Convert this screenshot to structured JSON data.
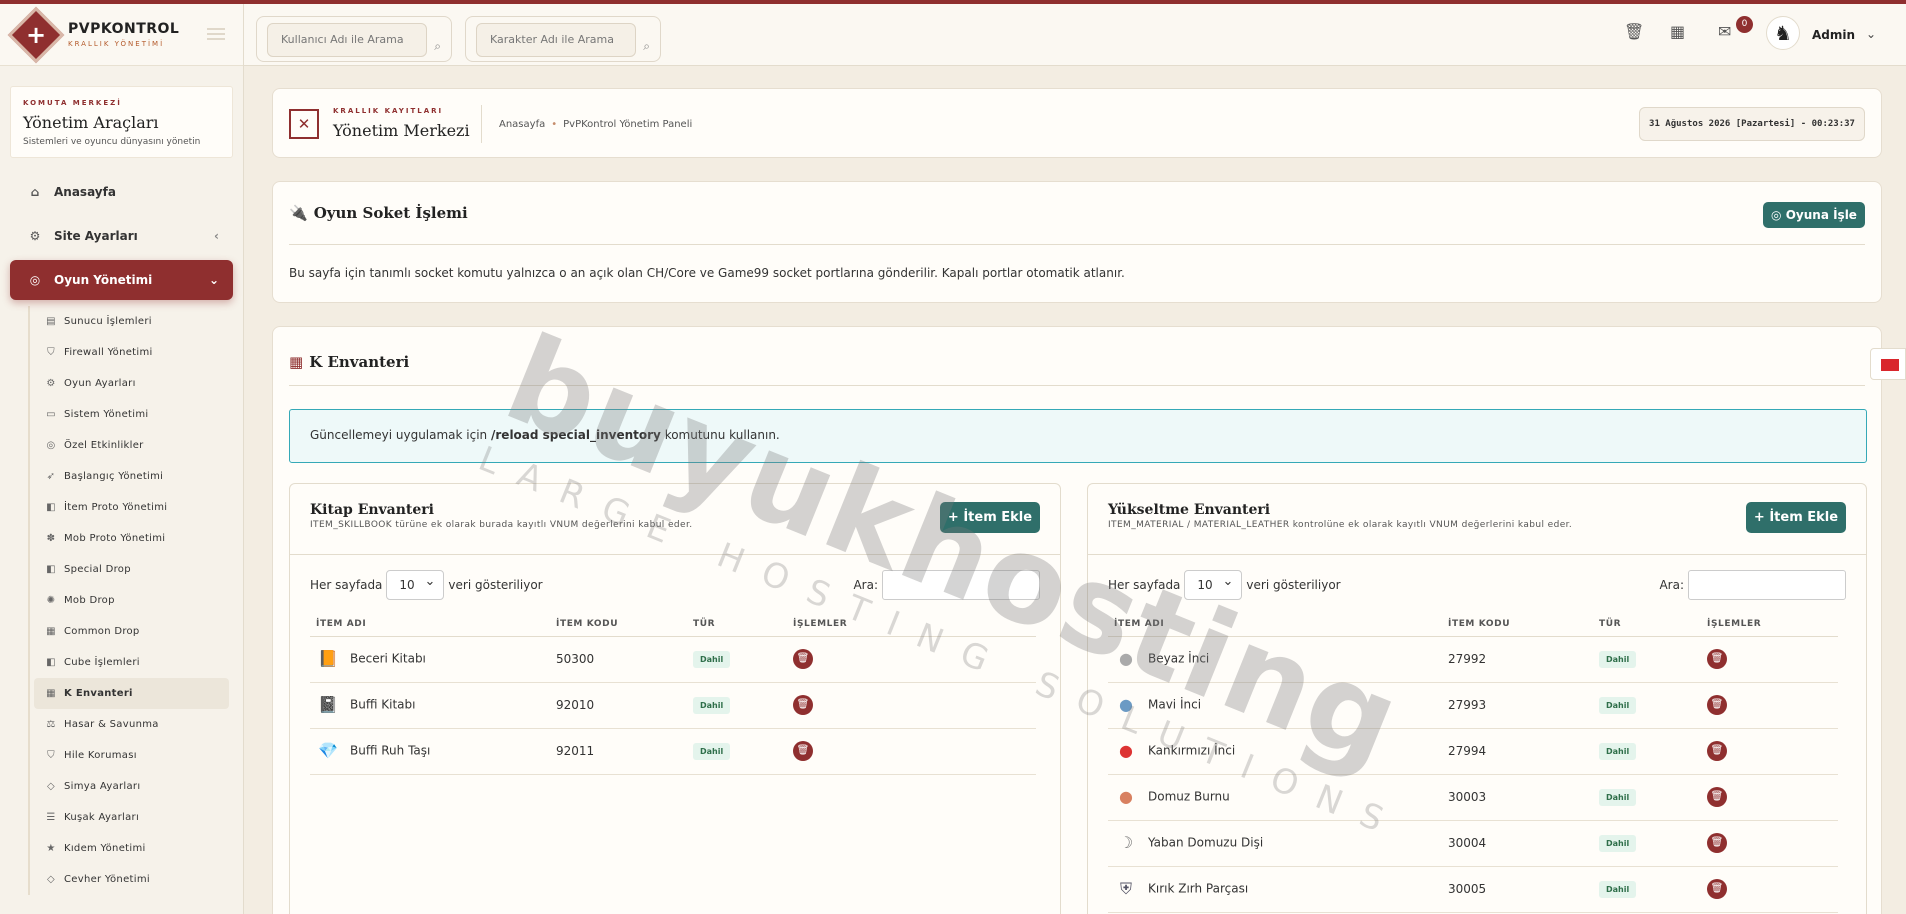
{
  "brand": {
    "title": "PVPKONTROL",
    "subtitle": "KRALLIK YÖNETİMİ"
  },
  "sidecard": {
    "small": "KOMUTA MERKEZİ",
    "title": "Yönetim Araçları",
    "subtitle": "Sistemleri ve oyuncu dünyasını yönetin"
  },
  "nav": {
    "home": "Anasayfa",
    "site_settings": "Site Ayarları",
    "game_management": "Oyun Yönetimi",
    "sub_items": [
      "Sunucu İşlemleri",
      "Firewall Yönetimi",
      "Oyun Ayarları",
      "Sistem Yönetimi",
      "Özel Etkinlikler",
      "Başlangıç Yönetimi",
      "İtem Proto Yönetimi",
      "Mob Proto Yönetimi",
      "Special Drop",
      "Mob Drop",
      "Common Drop",
      "Cube İşlemleri",
      "K Envanteri",
      "Hasar & Savunma",
      "Hile Koruması",
      "Simya Ayarları",
      "Kuşak Ayarları",
      "Kıdem Yönetimi",
      "Cevher Yönetimi"
    ]
  },
  "topbar": {
    "search_user_placeholder": "Kullanıcı Adı ile Arama",
    "search_char_placeholder": "Karakter Adı ile Arama",
    "notification_count": "0",
    "user_name": "Admin"
  },
  "header": {
    "small": "KRALLIK KAYITLARI",
    "title": "Yönetim Merkezi",
    "breadcrumb_home": "Anasayfa",
    "breadcrumb_current": "PvPKontrol Yönetim Paneli",
    "datetime": "31 Ağustos 2026 [Pazartesi] - 00:23:37"
  },
  "socket": {
    "title": "Oyun Soket İşlemi",
    "button": "Oyuna İşle",
    "text": "Bu sayfa için tanımlı socket komutu yalnızca o an açık olan CH/Core ve Game99 socket portlarına gönderilir. Kapalı portlar otomatik atlanır."
  },
  "kinv": {
    "title": "K Envanteri",
    "alert_pre": "Güncellemeyi uygulamak için",
    "alert_cmd": "/reload special_inventory",
    "alert_post": "komutunu kullanın."
  },
  "table_common": {
    "per_page_pre": "Her sayfada",
    "per_page_value": "10",
    "per_page_post": "veri gösteriliyor",
    "search_label": "Ara:",
    "col_name": "İTEM ADI",
    "col_code": "İTEM KODU",
    "col_type": "TÜR",
    "col_actions": "İŞLEMLER",
    "add_button": "İtem Ekle"
  },
  "book_inventory": {
    "title": "Kitap Envanteri",
    "desc": "ITEM_SKILLBOOK türüne ek olarak burada kayıtlı VNUM değerlerini kabul eder.",
    "rows": [
      {
        "name": "Beceri Kitabı",
        "code": "50300",
        "type": "Dahil"
      },
      {
        "name": "Buffi Kitabı",
        "code": "92010",
        "type": "Dahil"
      },
      {
        "name": "Buffi Ruh Taşı",
        "code": "92011",
        "type": "Dahil"
      }
    ]
  },
  "upgrade_inventory": {
    "title": "Yükseltme Envanteri",
    "desc": "ITEM_MATERIAL / MATERIAL_LEATHER kontrolüne ek olarak kayıtlı VNUM değerlerini kabul eder.",
    "rows": [
      {
        "name": "Beyaz İnci",
        "code": "27992",
        "type": "Dahil"
      },
      {
        "name": "Mavi İnci",
        "code": "27993",
        "type": "Dahil"
      },
      {
        "name": "Kankırmızı İnci",
        "code": "27994",
        "type": "Dahil"
      },
      {
        "name": "Domuz Burnu",
        "code": "30003",
        "type": "Dahil"
      },
      {
        "name": "Yaban Domuzu Dişi",
        "code": "30004",
        "type": "Dahil"
      },
      {
        "name": "Kırık Zırh Parçası",
        "code": "30005",
        "type": "Dahil"
      }
    ]
  },
  "watermark": {
    "main": "buyukhosting",
    "sub": "LARGE HOSTING SOLUTIONS"
  },
  "colors": {
    "accent": "#8f2f2f",
    "green": "#2f6f6a",
    "alert_border": "#35a9b7"
  }
}
